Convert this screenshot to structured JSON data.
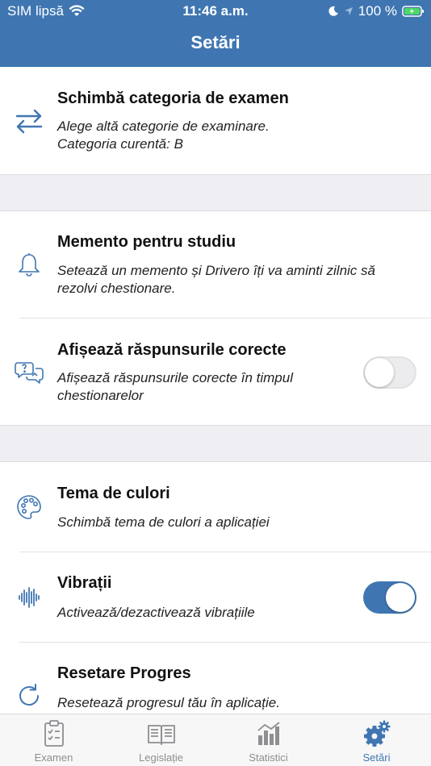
{
  "status_bar": {
    "carrier": "SIM lipsă",
    "time": "11:46 a.m.",
    "battery": "100 %"
  },
  "header": {
    "title": "Setări"
  },
  "settings": {
    "exam_category": {
      "title": "Schimbă categoria de examen",
      "desc_line1": "Alege altă categorie de examinare.",
      "desc_line2": "Categoria curentă: B"
    },
    "study_reminder": {
      "title": "Memento pentru studiu",
      "desc": "Setează un memento și Drivero îți va aminti zilnic să rezolvi chestionare."
    },
    "show_answers": {
      "title": "Afișează răspunsurile corecte",
      "desc": "Afișează răspunsurile corecte în timpul chestionarelor",
      "enabled": false
    },
    "color_theme": {
      "title": "Tema de culori",
      "desc": "Schimbă tema de culori a aplicației"
    },
    "vibrations": {
      "title": "Vibrații",
      "desc": "Activează/dezactivează vibrațiile",
      "enabled": true
    },
    "reset_progress": {
      "title": "Resetare Progres",
      "desc": "Resetează progresul tău în aplicație."
    }
  },
  "tabs": [
    {
      "label": "Examen",
      "icon": "clipboard-icon",
      "active": false
    },
    {
      "label": "Legislație",
      "icon": "book-icon",
      "active": false
    },
    {
      "label": "Statistici",
      "icon": "chart-icon",
      "active": false
    },
    {
      "label": "Setări",
      "icon": "gear-icon",
      "active": true
    }
  ],
  "colors": {
    "accent": "#3f76b2",
    "inactive": "#8e8e93",
    "battery": "#4cd964"
  }
}
